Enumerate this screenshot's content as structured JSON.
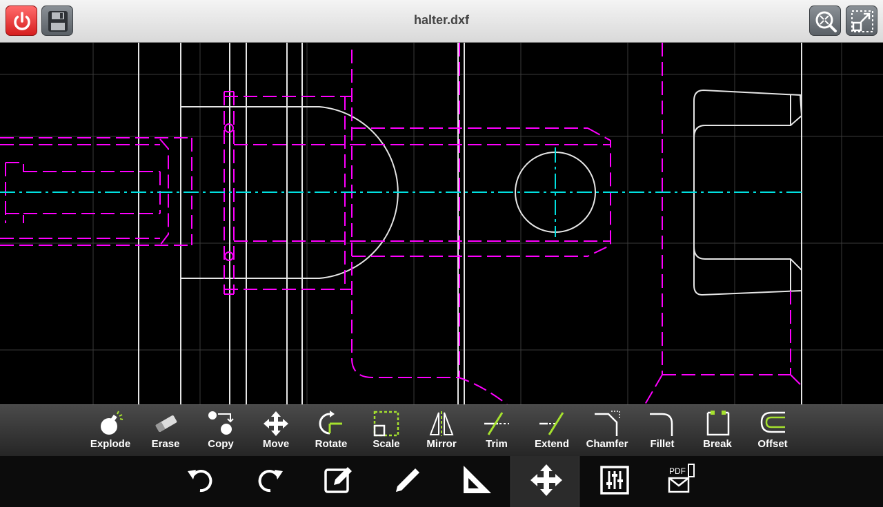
{
  "window": {
    "title": "halter.dxf"
  },
  "header_buttons": {
    "power": "power-icon",
    "save": "floppy-disk-icon",
    "zoom_extents": "zoom-extents-icon",
    "fullscreen": "fullscreen-icon"
  },
  "modify_tools": [
    {
      "label": "Explode",
      "icon": "bomb-icon"
    },
    {
      "label": "Erase",
      "icon": "eraser-icon"
    },
    {
      "label": "Copy",
      "icon": "copy-icon"
    },
    {
      "label": "Move",
      "icon": "move-arrows-icon"
    },
    {
      "label": "Rotate",
      "icon": "rotate-icon"
    },
    {
      "label": "Scale",
      "icon": "scale-icon"
    },
    {
      "label": "Mirror",
      "icon": "mirror-icon"
    },
    {
      "label": "Trim",
      "icon": "trim-icon"
    },
    {
      "label": "Extend",
      "icon": "extend-icon"
    },
    {
      "label": "Chamfer",
      "icon": "chamfer-icon"
    },
    {
      "label": "Fillet",
      "icon": "fillet-icon"
    },
    {
      "label": "Break",
      "icon": "break-icon"
    },
    {
      "label": "Offset",
      "icon": "offset-icon"
    }
  ],
  "bottom_tools": [
    {
      "name": "undo",
      "icon": "undo-icon"
    },
    {
      "name": "redo",
      "icon": "redo-icon"
    },
    {
      "name": "edit",
      "icon": "edit-icon"
    },
    {
      "name": "draw",
      "icon": "pencil-icon"
    },
    {
      "name": "measure",
      "icon": "set-square-icon"
    },
    {
      "name": "modify",
      "icon": "move-arrows-icon",
      "active": true
    },
    {
      "name": "settings",
      "icon": "sliders-icon"
    },
    {
      "name": "export-pdf",
      "icon": "pdf-export-icon",
      "text": "PDF"
    }
  ],
  "colors": {
    "canvas_bg": "#000000",
    "grid": "#3a3a3a",
    "white_lines": "#e6e6e6",
    "magenta_lines": "#ff00ff",
    "cyan_centerline": "#00e0e0",
    "accent_green": "#a6e22e",
    "power_red": "#e53030"
  }
}
